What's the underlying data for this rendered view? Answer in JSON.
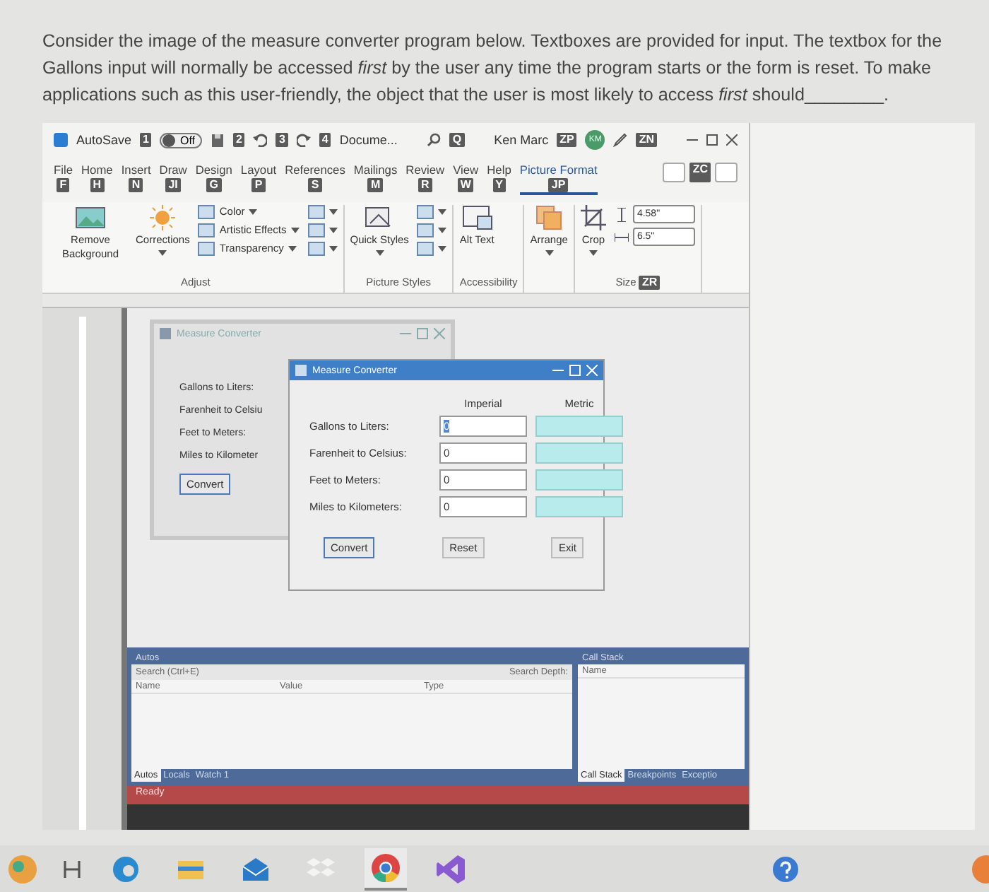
{
  "question": {
    "text": "Consider the image of the measure converter program below.  Textboxes are provided for input.  The textbox for the Gallons input will normally be accessed *first* by the user any time the program starts or the form is reset.  To make applications such as this user-friendly, the object that the user is most likely to access *first* should________."
  },
  "word": {
    "title_bar": {
      "autosave_label": "AutoSave",
      "autosave_keytip": "1",
      "autosave": {
        "on": false,
        "label": "Off"
      },
      "quick_access": [
        {
          "kind": "save",
          "keytip": "2"
        },
        {
          "kind": "undo",
          "keytip": "3"
        },
        {
          "kind": "redo",
          "keytip": "4"
        }
      ],
      "document_title": "Docume...",
      "search_keytip": "Q",
      "user_name": "Ken Marc",
      "user_keytip": "ZP",
      "avatar": "KM",
      "pen_keytip": "ZN"
    },
    "tabs": [
      {
        "label": "File",
        "keytip": "F",
        "selected": false
      },
      {
        "label": "Home",
        "keytip": "H",
        "selected": false
      },
      {
        "label": "Insert",
        "keytip": "N",
        "selected": false
      },
      {
        "label": "Draw",
        "keytip": "JI",
        "selected": false
      },
      {
        "label": "Design",
        "keytip": "G",
        "selected": false
      },
      {
        "label": "Layout",
        "keytip": "P",
        "selected": false
      },
      {
        "label": "References",
        "keytip": "S",
        "selected": false
      },
      {
        "label": "Mailings",
        "keytip": "M",
        "selected": false
      },
      {
        "label": "Review",
        "keytip": "R",
        "selected": false
      },
      {
        "label": "View",
        "keytip": "W",
        "selected": false
      },
      {
        "label": "Help",
        "keytip": "Y",
        "selected": false
      },
      {
        "label": "Picture Format",
        "keytip": "JP",
        "selected": true
      }
    ],
    "comments_keytip": "ZC",
    "groups": [
      {
        "label": "Adjust",
        "items": [
          {
            "kind": "remove-background",
            "label": "Remove Background",
            "dropdown": false
          },
          {
            "kind": "corrections",
            "label": "Corrections",
            "dropdown": true
          },
          {
            "kind": "stack",
            "items": [
              {
                "label": "Color",
                "dropdown": true
              },
              {
                "label": "Artistic Effects",
                "dropdown": true
              },
              {
                "label": "Transparency",
                "dropdown": true
              }
            ]
          },
          {
            "kind": "icons"
          }
        ]
      },
      {
        "label": "Picture Styles",
        "items": [
          {
            "kind": "quick-styles",
            "label": "Quick Styles",
            "dropdown": true
          },
          {
            "kind": "icons"
          }
        ]
      },
      {
        "label": "Accessibility",
        "items": [
          {
            "kind": "alt-text",
            "label": "Alt Text",
            "dropdown": false
          }
        ]
      },
      {
        "items": [
          {
            "kind": "arrange",
            "label": "Arrange",
            "dropdown": true
          }
        ]
      },
      {
        "label": "Size",
        "items": [
          {
            "kind": "crop",
            "label": "Crop",
            "dropdown": true
          },
          {
            "kind": "sizes",
            "fields": [
              {
                "kind": "height",
                "value": "4.58\""
              },
              {
                "kind": "width",
                "value": "6.5\""
              }
            ]
          }
        ]
      }
    ],
    "ribbon_keytip": "ZR"
  },
  "vs": {
    "back_form": {
      "title": "Measure Converter",
      "labels": [
        "Gallons to Liters:",
        "Farenheit to Celsiu",
        "Feet to Meters:",
        "Miles to Kilometer"
      ],
      "button": "Convert"
    },
    "front_form": {
      "title": "Measure Converter",
      "headers": [
        "Imperial",
        "Metric"
      ],
      "rows": [
        {
          "label": "Gallons to Liters:",
          "value": "0",
          "selected": true
        },
        {
          "label": "Farenheit to Celsius:",
          "value": "0",
          "selected": false
        },
        {
          "label": "Feet to Meters:",
          "value": "0",
          "selected": false
        },
        {
          "label": "Miles to Kilometers:",
          "value": "0",
          "selected": false
        }
      ],
      "buttons": [
        "Convert",
        "Reset",
        "Exit"
      ]
    },
    "autos": {
      "title": "Autos",
      "search_placeholder": "Search (Ctrl+E)",
      "search_depth": "Search Depth:",
      "columns": [
        "Name",
        "Value",
        "Type"
      ],
      "tabs": [
        {
          "label": "Autos",
          "selected": true
        },
        {
          "label": "Locals",
          "selected": false
        },
        {
          "label": "Watch 1",
          "selected": false
        }
      ]
    },
    "call_stack": {
      "title": "Call Stack",
      "columns": [
        "Name"
      ],
      "tabs": [
        {
          "label": "Call Stack",
          "selected": true
        },
        {
          "label": "Breakpoints",
          "selected": false
        },
        {
          "label": "Exceptio",
          "selected": false
        }
      ]
    },
    "status": "Ready"
  },
  "taskbar": {
    "apps": [
      {
        "kind": "edge",
        "selected": false
      },
      {
        "kind": "folder",
        "selected": false
      },
      {
        "kind": "mail",
        "selected": false
      },
      {
        "kind": "dropbox",
        "selected": false
      },
      {
        "kind": "chrome",
        "selected": true
      },
      {
        "kind": "visual-studio",
        "selected": false
      }
    ]
  }
}
